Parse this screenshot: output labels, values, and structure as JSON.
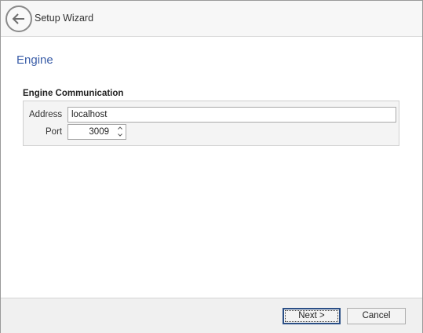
{
  "header": {
    "title": "Setup Wizard",
    "back_icon": "arrow-left-icon"
  },
  "page": {
    "title": "Engine"
  },
  "engine_communication": {
    "group_label": "Engine Communication",
    "address_label": "Address",
    "address_value": "localhost",
    "port_label": "Port",
    "port_value": "3009"
  },
  "footer": {
    "next_label": "Next >",
    "cancel_label": "Cancel"
  },
  "colors": {
    "accent_title": "#3b5ea8",
    "default_button_border": "#2b4f86"
  }
}
